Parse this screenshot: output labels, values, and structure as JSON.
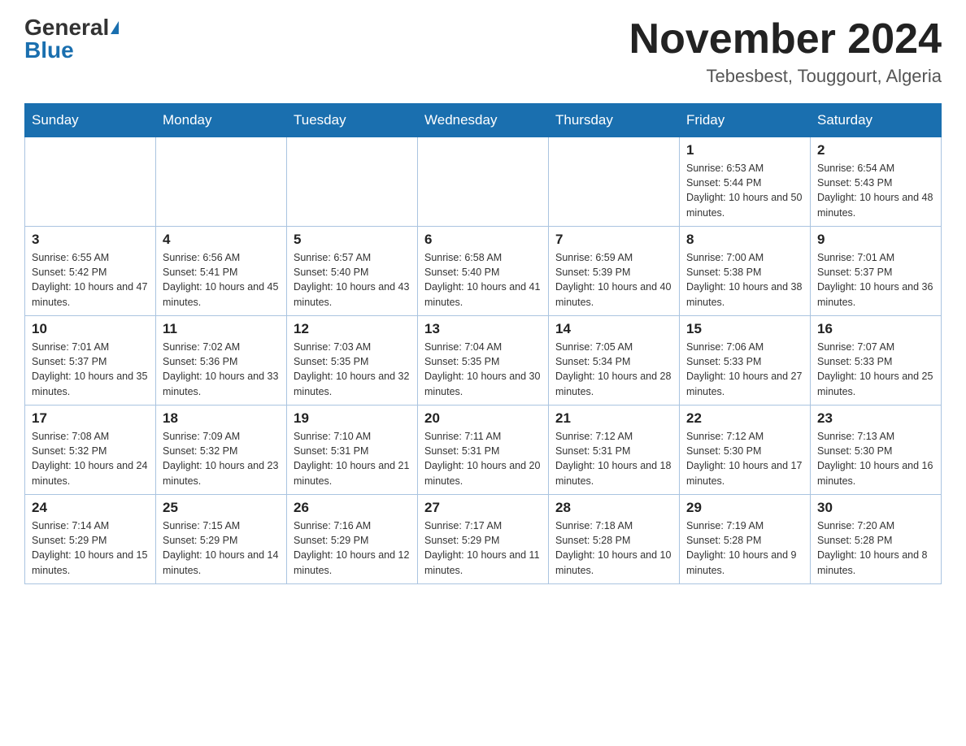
{
  "header": {
    "logo_general": "General",
    "logo_blue": "Blue",
    "month_title": "November 2024",
    "location": "Tebesbest, Touggourt, Algeria"
  },
  "weekdays": [
    "Sunday",
    "Monday",
    "Tuesday",
    "Wednesday",
    "Thursday",
    "Friday",
    "Saturday"
  ],
  "weeks": [
    [
      {
        "day": "",
        "sunrise": "",
        "sunset": "",
        "daylight": ""
      },
      {
        "day": "",
        "sunrise": "",
        "sunset": "",
        "daylight": ""
      },
      {
        "day": "",
        "sunrise": "",
        "sunset": "",
        "daylight": ""
      },
      {
        "day": "",
        "sunrise": "",
        "sunset": "",
        "daylight": ""
      },
      {
        "day": "",
        "sunrise": "",
        "sunset": "",
        "daylight": ""
      },
      {
        "day": "1",
        "sunrise": "Sunrise: 6:53 AM",
        "sunset": "Sunset: 5:44 PM",
        "daylight": "Daylight: 10 hours and 50 minutes."
      },
      {
        "day": "2",
        "sunrise": "Sunrise: 6:54 AM",
        "sunset": "Sunset: 5:43 PM",
        "daylight": "Daylight: 10 hours and 48 minutes."
      }
    ],
    [
      {
        "day": "3",
        "sunrise": "Sunrise: 6:55 AM",
        "sunset": "Sunset: 5:42 PM",
        "daylight": "Daylight: 10 hours and 47 minutes."
      },
      {
        "day": "4",
        "sunrise": "Sunrise: 6:56 AM",
        "sunset": "Sunset: 5:41 PM",
        "daylight": "Daylight: 10 hours and 45 minutes."
      },
      {
        "day": "5",
        "sunrise": "Sunrise: 6:57 AM",
        "sunset": "Sunset: 5:40 PM",
        "daylight": "Daylight: 10 hours and 43 minutes."
      },
      {
        "day": "6",
        "sunrise": "Sunrise: 6:58 AM",
        "sunset": "Sunset: 5:40 PM",
        "daylight": "Daylight: 10 hours and 41 minutes."
      },
      {
        "day": "7",
        "sunrise": "Sunrise: 6:59 AM",
        "sunset": "Sunset: 5:39 PM",
        "daylight": "Daylight: 10 hours and 40 minutes."
      },
      {
        "day": "8",
        "sunrise": "Sunrise: 7:00 AM",
        "sunset": "Sunset: 5:38 PM",
        "daylight": "Daylight: 10 hours and 38 minutes."
      },
      {
        "day": "9",
        "sunrise": "Sunrise: 7:01 AM",
        "sunset": "Sunset: 5:37 PM",
        "daylight": "Daylight: 10 hours and 36 minutes."
      }
    ],
    [
      {
        "day": "10",
        "sunrise": "Sunrise: 7:01 AM",
        "sunset": "Sunset: 5:37 PM",
        "daylight": "Daylight: 10 hours and 35 minutes."
      },
      {
        "day": "11",
        "sunrise": "Sunrise: 7:02 AM",
        "sunset": "Sunset: 5:36 PM",
        "daylight": "Daylight: 10 hours and 33 minutes."
      },
      {
        "day": "12",
        "sunrise": "Sunrise: 7:03 AM",
        "sunset": "Sunset: 5:35 PM",
        "daylight": "Daylight: 10 hours and 32 minutes."
      },
      {
        "day": "13",
        "sunrise": "Sunrise: 7:04 AM",
        "sunset": "Sunset: 5:35 PM",
        "daylight": "Daylight: 10 hours and 30 minutes."
      },
      {
        "day": "14",
        "sunrise": "Sunrise: 7:05 AM",
        "sunset": "Sunset: 5:34 PM",
        "daylight": "Daylight: 10 hours and 28 minutes."
      },
      {
        "day": "15",
        "sunrise": "Sunrise: 7:06 AM",
        "sunset": "Sunset: 5:33 PM",
        "daylight": "Daylight: 10 hours and 27 minutes."
      },
      {
        "day": "16",
        "sunrise": "Sunrise: 7:07 AM",
        "sunset": "Sunset: 5:33 PM",
        "daylight": "Daylight: 10 hours and 25 minutes."
      }
    ],
    [
      {
        "day": "17",
        "sunrise": "Sunrise: 7:08 AM",
        "sunset": "Sunset: 5:32 PM",
        "daylight": "Daylight: 10 hours and 24 minutes."
      },
      {
        "day": "18",
        "sunrise": "Sunrise: 7:09 AM",
        "sunset": "Sunset: 5:32 PM",
        "daylight": "Daylight: 10 hours and 23 minutes."
      },
      {
        "day": "19",
        "sunrise": "Sunrise: 7:10 AM",
        "sunset": "Sunset: 5:31 PM",
        "daylight": "Daylight: 10 hours and 21 minutes."
      },
      {
        "day": "20",
        "sunrise": "Sunrise: 7:11 AM",
        "sunset": "Sunset: 5:31 PM",
        "daylight": "Daylight: 10 hours and 20 minutes."
      },
      {
        "day": "21",
        "sunrise": "Sunrise: 7:12 AM",
        "sunset": "Sunset: 5:31 PM",
        "daylight": "Daylight: 10 hours and 18 minutes."
      },
      {
        "day": "22",
        "sunrise": "Sunrise: 7:12 AM",
        "sunset": "Sunset: 5:30 PM",
        "daylight": "Daylight: 10 hours and 17 minutes."
      },
      {
        "day": "23",
        "sunrise": "Sunrise: 7:13 AM",
        "sunset": "Sunset: 5:30 PM",
        "daylight": "Daylight: 10 hours and 16 minutes."
      }
    ],
    [
      {
        "day": "24",
        "sunrise": "Sunrise: 7:14 AM",
        "sunset": "Sunset: 5:29 PM",
        "daylight": "Daylight: 10 hours and 15 minutes."
      },
      {
        "day": "25",
        "sunrise": "Sunrise: 7:15 AM",
        "sunset": "Sunset: 5:29 PM",
        "daylight": "Daylight: 10 hours and 14 minutes."
      },
      {
        "day": "26",
        "sunrise": "Sunrise: 7:16 AM",
        "sunset": "Sunset: 5:29 PM",
        "daylight": "Daylight: 10 hours and 12 minutes."
      },
      {
        "day": "27",
        "sunrise": "Sunrise: 7:17 AM",
        "sunset": "Sunset: 5:29 PM",
        "daylight": "Daylight: 10 hours and 11 minutes."
      },
      {
        "day": "28",
        "sunrise": "Sunrise: 7:18 AM",
        "sunset": "Sunset: 5:28 PM",
        "daylight": "Daylight: 10 hours and 10 minutes."
      },
      {
        "day": "29",
        "sunrise": "Sunrise: 7:19 AM",
        "sunset": "Sunset: 5:28 PM",
        "daylight": "Daylight: 10 hours and 9 minutes."
      },
      {
        "day": "30",
        "sunrise": "Sunrise: 7:20 AM",
        "sunset": "Sunset: 5:28 PM",
        "daylight": "Daylight: 10 hours and 8 minutes."
      }
    ]
  ]
}
